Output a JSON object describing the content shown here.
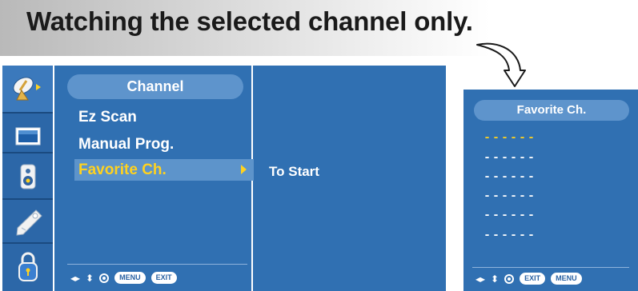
{
  "heading": "Watching the selected channel only.",
  "left_osd": {
    "sidebar_icons": [
      "satellite-dish-icon",
      "monitor-screen-icon",
      "speaker-audio-icon",
      "tag-option-icon",
      "lock-icon"
    ],
    "menu_title": "Channel",
    "menu_items": [
      {
        "label": "Ez Scan",
        "selected": false
      },
      {
        "label": "Manual Prog.",
        "selected": false
      },
      {
        "label": "Favorite Ch.",
        "selected": true
      }
    ],
    "submenu_item": "To Start",
    "footer": {
      "menu_key": "MENU",
      "exit_key": "EXIT"
    }
  },
  "right_osd": {
    "title": "Favorite Ch.",
    "slots": [
      "------",
      "------",
      "------",
      "------",
      "------",
      "------"
    ],
    "footer": {
      "exit_key": "EXIT",
      "menu_key": "MENU"
    }
  },
  "colors": {
    "osd_bg": "#3070b2",
    "pill_bg": "#5e94cc",
    "highlight_text": "#ffd21f",
    "title_band": "#c8c8c8"
  }
}
